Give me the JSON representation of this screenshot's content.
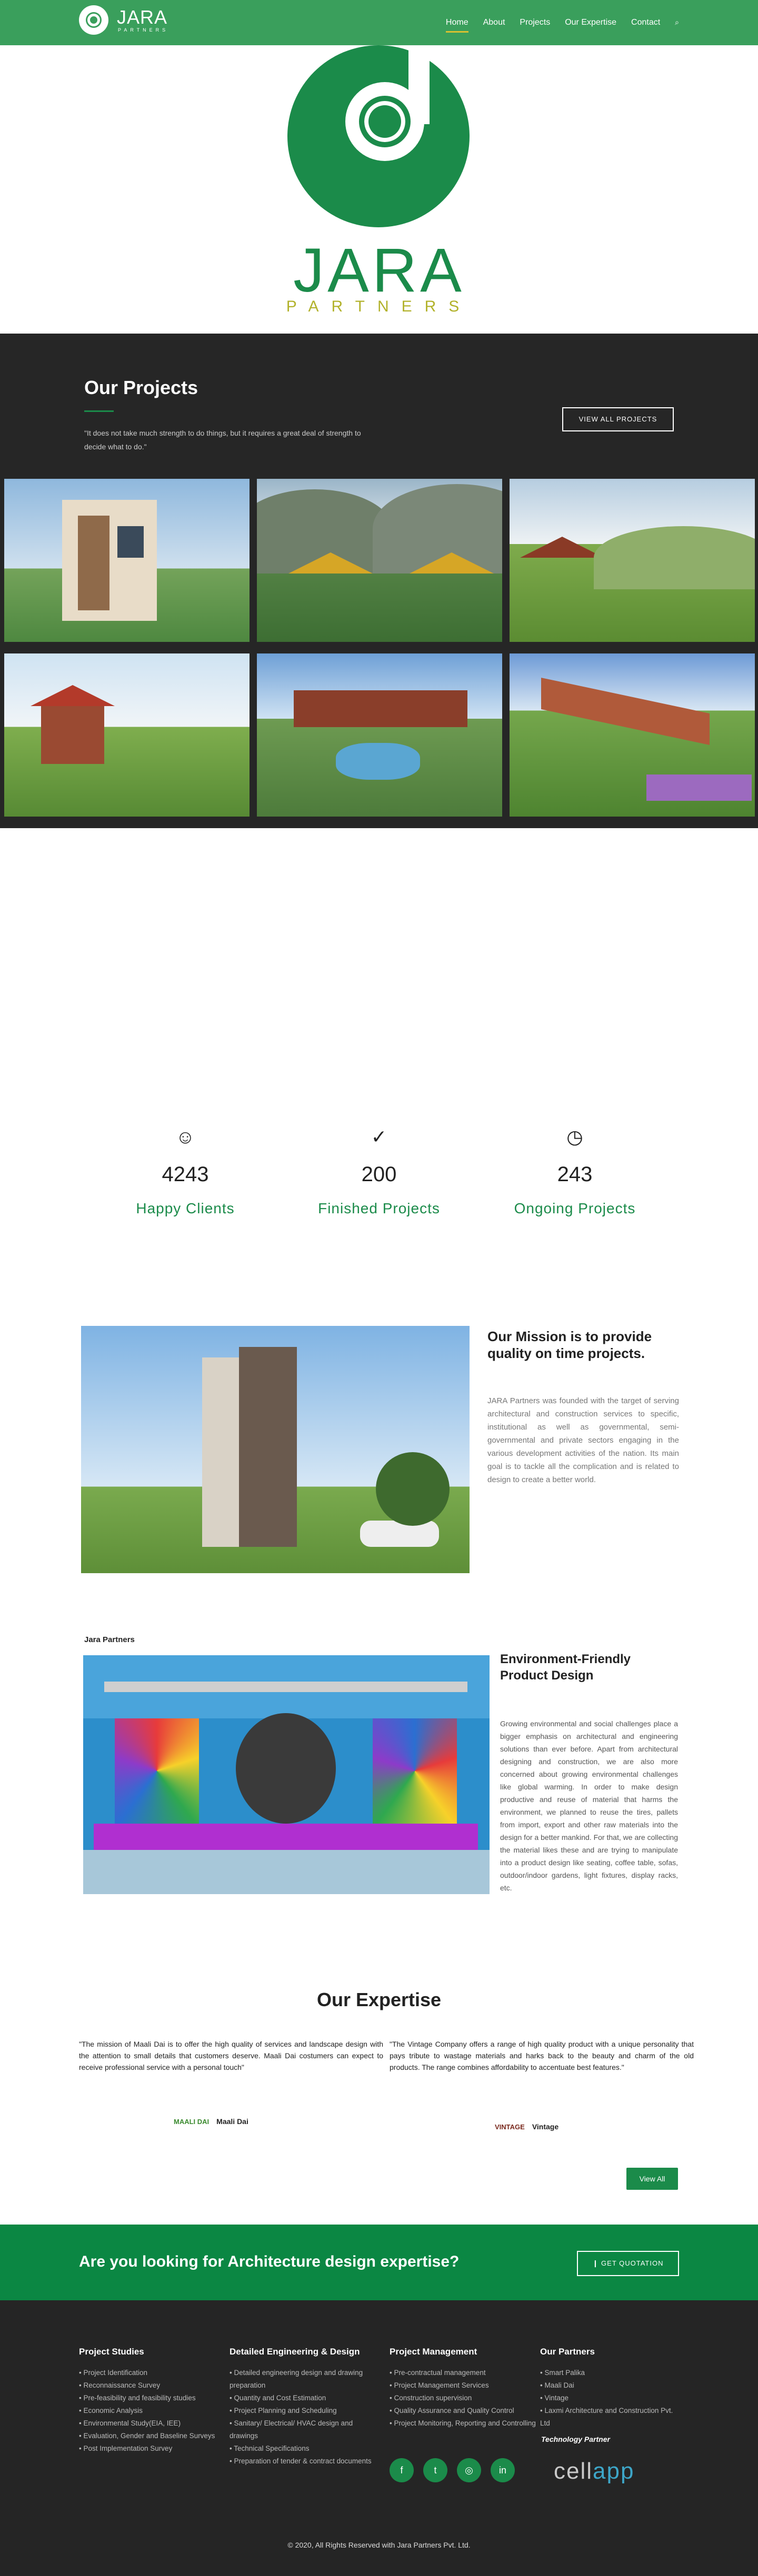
{
  "nav": {
    "logo_name": "JARA",
    "logo_sub": "PARTNERS",
    "items": [
      "Home",
      "About",
      "Projects",
      "Our Expertise",
      "Contact"
    ],
    "search_icon": "search-icon"
  },
  "hero": {
    "name": "JARA",
    "sub": "PARTNERS",
    "colors": {
      "green": "#1b8b4a",
      "gold": "#b2b22b"
    }
  },
  "projects": {
    "title": "Our Projects",
    "quote": "\"It does not take much strength to do things, but it requires a great deal of strength to decide what to do.\"",
    "button": "VIEW ALL PROJECTS"
  },
  "stats": [
    {
      "icon": "smile-icon",
      "number": "4243",
      "label": "Happy Clients"
    },
    {
      "icon": "check-icon",
      "number": "200",
      "label": "Finished Projects"
    },
    {
      "icon": "clock-icon",
      "number": "243",
      "label": "Ongoing Projects"
    }
  ],
  "mission": {
    "title": "Our Mission is to provide quality on time projects.",
    "text": "JARA Partners was founded with the target of serving architectural and construction services to specific, institutional as well as governmental, semi-governmental and private sectors engaging in the various development activities of the nation. Its main goal is to tackle all the complication and is related to design to create a better world."
  },
  "env": {
    "label": "Jara Partners",
    "title": "Environment-Friendly Product Design",
    "text": "Growing environmental and social challenges place a bigger emphasis on architectural and engineering solutions than ever before. Apart from architectural designing and construction, we are also more concerned about growing environmental challenges like global warming. In order to make design productive and reuse of material that harms the environment, we planned to reuse the tires, pallets from import, export and other raw materials into the design for a better mankind. For that, we are collecting the material likes these and are trying to manipulate into a product design like seating, coffee table, sofas, outdoor/indoor gardens, light fixtures, display racks, etc."
  },
  "expertise": {
    "title": "Our Expertise",
    "cards": [
      {
        "text": "\"The mission of Maali Dai is to offer the high quality of services and landscape design with the attention to small details that customers deserve. Maali Dai costumers can expect to receive professional service with a personal touch\"",
        "brand": "Maali Dai",
        "logo": "MAALI DAI"
      },
      {
        "text": "\"The Vintage Company offers a range of high quality product with a unique personality that pays tribute to wastage materials and harks back to the beauty and charm of the old products. The range combines affordability to accentuate best features.\"",
        "brand": "Vintage",
        "logo": "VINTAGE"
      }
    ],
    "view_all": "View All"
  },
  "cta": {
    "title": "Are you looking for Architecture design expertise?",
    "button": "GET QUOTATION"
  },
  "footer": {
    "col1": {
      "title": "Project Studies",
      "items": [
        "Project Identification",
        "Reconnaissance Survey",
        "Pre-feasibility and feasibility studies",
        "Economic Analysis",
        "Environmental Study(EIA, IEE)",
        "Evaluation, Gender and Baseline Surveys",
        "Post Implementation Survey"
      ]
    },
    "col2": {
      "title": "Detailed Engineering & Design",
      "items": [
        "Detailed engineering design and drawing preparation",
        "Quantity and Cost Estimation",
        "Project Planning and Scheduling",
        "Sanitary/ Electrical/ HVAC design and drawings",
        "Technical Specifications",
        "Preparation of tender & contract documents"
      ]
    },
    "col3": {
      "title": "Project Management",
      "items": [
        "Pre-contractual management",
        "Project Management Services",
        "Construction supervision",
        "Quality Assurance and Quality Control",
        "Project Monitoring, Reporting and Controlling"
      ]
    },
    "col4": {
      "title": "Our Partners",
      "items": [
        "Smart Palika",
        "Maali Dai",
        "Vintage",
        "Laxmi Architecture and Construction Pvt. Ltd"
      ]
    },
    "tech_partner": "Technology Partner",
    "cell_a": "cell",
    "cell_b": "app",
    "social": [
      "facebook-icon",
      "twitter-icon",
      "instagram-icon",
      "linkedin-icon"
    ],
    "copyright": "© 2020, All Rights Reserved with Jara Partners Pvt. Ltd."
  }
}
